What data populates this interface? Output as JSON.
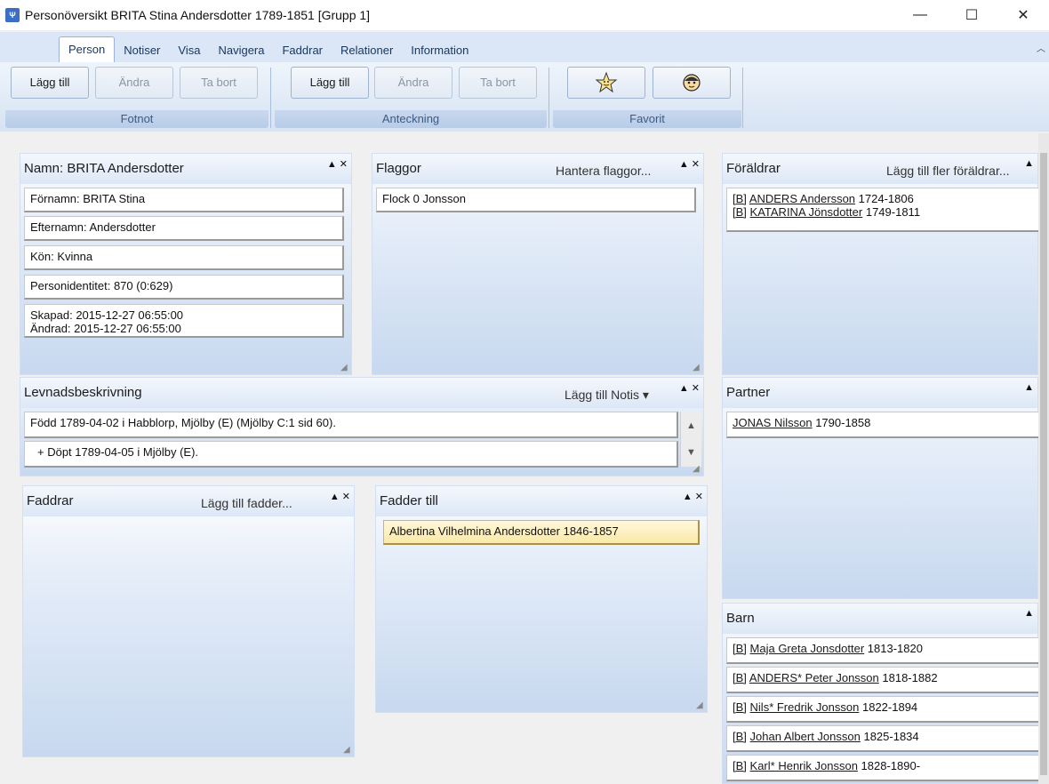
{
  "window": {
    "title": "Personöversikt BRITA Stina Andersdotter 1789-1851 [Grupp 1]",
    "minimize": "—",
    "maximize": "☐",
    "close": "✕"
  },
  "ribbon": {
    "tabs": [
      "Person",
      "Notiser",
      "Visa",
      "Navigera",
      "Faddrar",
      "Relationer",
      "Information"
    ],
    "groups": {
      "fotnot": {
        "label": "Fotnot",
        "add": "Lägg till",
        "edit": "Ändra",
        "remove": "Ta bort"
      },
      "anteckning": {
        "label": "Anteckning",
        "add": "Lägg till",
        "edit": "Ändra",
        "remove": "Ta bort"
      },
      "favorit": {
        "label": "Favorit"
      }
    }
  },
  "panels": {
    "namn": {
      "title": "Namn: BRITA Andersdotter",
      "fornamn": "Förnamn: BRITA Stina",
      "efternamn": "Efternamn: Andersdotter",
      "kon": "Kön: Kvinna",
      "personid": "Personidentitet: 870 (0:629)",
      "skapad": "Skapad: 2015-12-27 06:55:00",
      "andrad": "Ändrad: 2015-12-27 06:55:00"
    },
    "flaggor": {
      "title": "Flaggor",
      "link": "Hantera flaggor...",
      "items": [
        "Flock 0 Jonsson"
      ]
    },
    "foraldrar": {
      "title": "Föräldrar",
      "link": "Lägg till fler föräldrar...",
      "items": [
        {
          "tag": "[B]",
          "name": "ANDERS Andersson",
          "years": "1724-1806"
        },
        {
          "tag": "[B]",
          "name": "KATARINA Jönsdotter",
          "years": "1749-1811"
        }
      ]
    },
    "levnad": {
      "title": "Levnadsbeskrivning",
      "link": "Lägg till Notis",
      "rows": [
        "Född 1789-04-02 i Habblorp, Mjölby (E) (Mjölby C:1 sid  60).",
        "+ Döpt 1789-04-05 i Mjölby (E)."
      ]
    },
    "partner": {
      "title": "Partner",
      "items": [
        {
          "name": "JONAS Nilsson",
          "years": "1790-1858"
        }
      ]
    },
    "faddrar": {
      "title": "Faddrar",
      "link": "Lägg till fadder..."
    },
    "fadder_till": {
      "title": "Fadder till",
      "items": [
        "Albertina Vilhelmina Andersdotter 1846-1857"
      ]
    },
    "barn": {
      "title": "Barn",
      "items": [
        {
          "tag": "[B]",
          "name": "Maja Greta Jonsdotter",
          "years": "1813-1820"
        },
        {
          "tag": "[B]",
          "name": "ANDERS* Peter Jonsson",
          "years": "1818-1882"
        },
        {
          "tag": "[B]",
          "name": "Nils* Fredrik Jonsson",
          "years": "1822-1894"
        },
        {
          "tag": "[B]",
          "name": "Johan Albert Jonsson",
          "years": "1825-1834"
        },
        {
          "tag": "[B]",
          "name": "Karl* Henrik Jonsson",
          "years": "1828-1890-"
        }
      ]
    }
  }
}
